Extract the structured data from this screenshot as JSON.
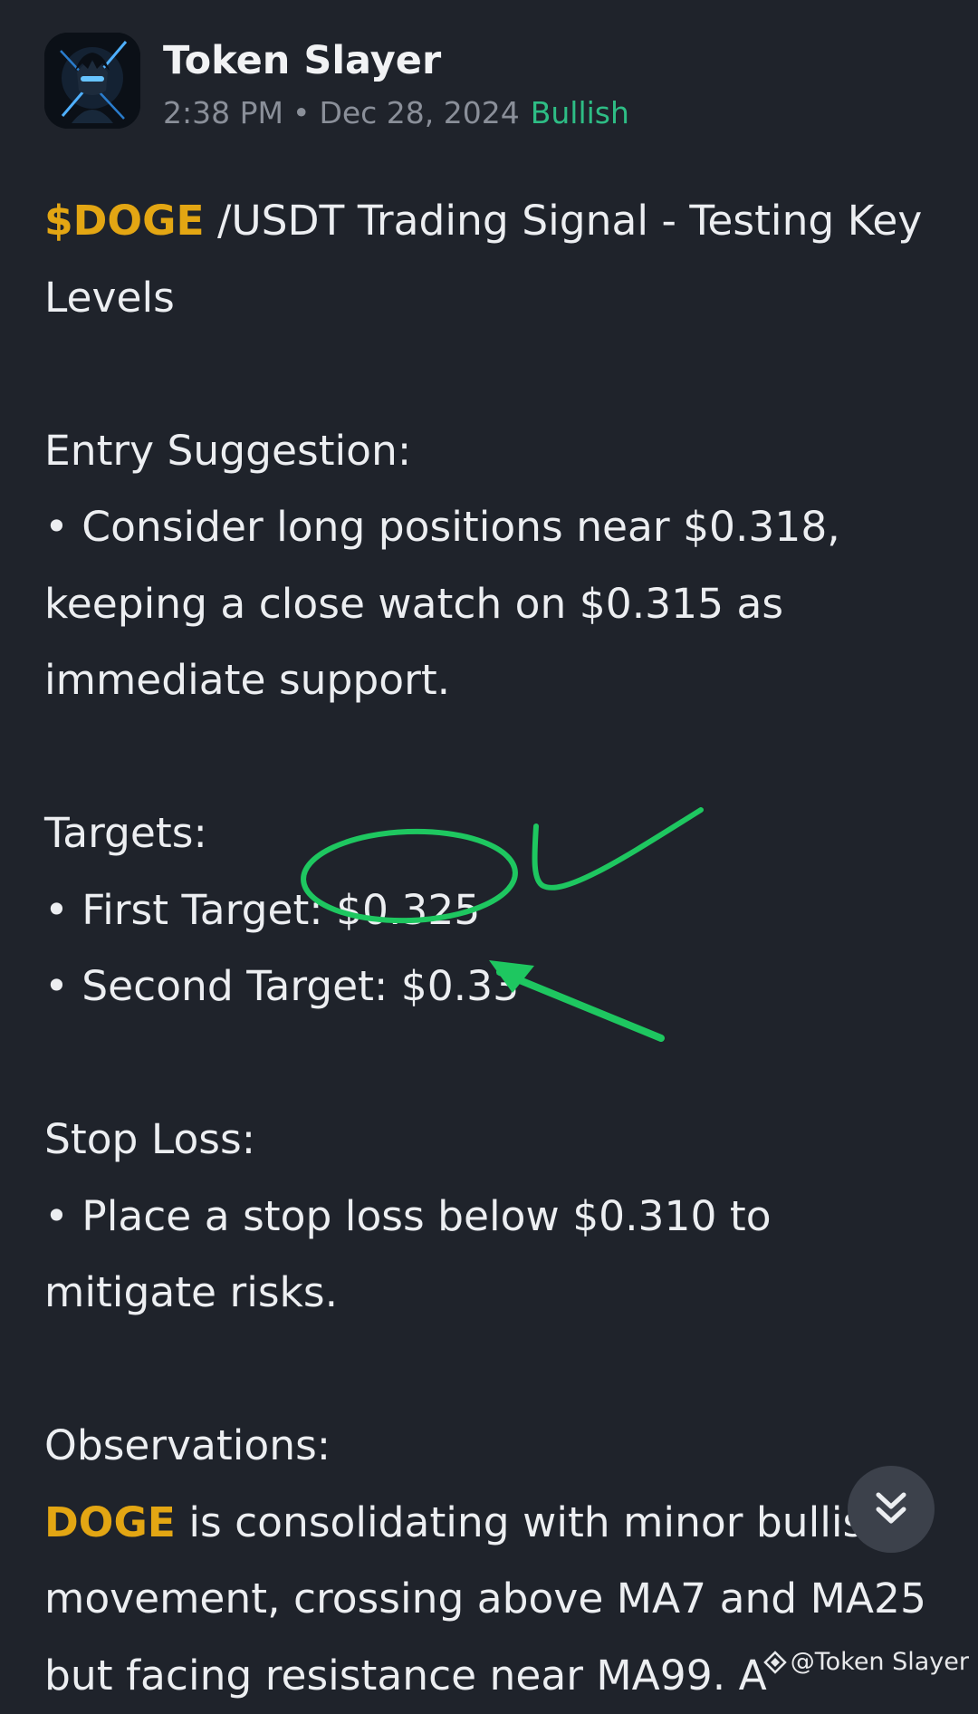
{
  "author": {
    "name": "Token Slayer",
    "avatar_icon": "ninja-avatar-icon"
  },
  "meta": {
    "time": "2:38 PM",
    "separator": "•",
    "date": "Dec 28, 2024",
    "sentiment": "Bullish",
    "sentiment_color": "#2ebd85"
  },
  "post": {
    "title_ticker": "$DOGE",
    "title_rest_1": " /USDT Trading Signal - Testing Key",
    "title_rest_2": "Levels",
    "entry_heading": "Entry Suggestion:",
    "entry_line_1": "• Consider long positions near $0.318,",
    "entry_line_2": "keeping a close watch on $0.315 as",
    "entry_line_3": "immediate support.",
    "targets_heading": "Targets:",
    "target_1": "• First Target: $0.325",
    "target_2": "• Second Target: $0.33",
    "stop_heading": "Stop Loss:",
    "stop_line_1": "• Place a stop loss below $0.310 to",
    "stop_line_2": "mitigate risks.",
    "obs_heading": "Observations:",
    "obs_ticker": "DOGE",
    "obs_line_1_rest": " is consolidating with minor bullish",
    "obs_line_2": "movement, crossing above MA7 and MA25",
    "obs_line_3": "but facing resistance near MA99. A"
  },
  "colors": {
    "background": "#1f232b",
    "ticker": "#e3a613",
    "annotation": "#1ec760"
  },
  "scroll_button": {
    "icon": "double-chevron-down-icon"
  },
  "watermark": {
    "icon": "binance-square-icon",
    "text": "@Token Slayer"
  }
}
